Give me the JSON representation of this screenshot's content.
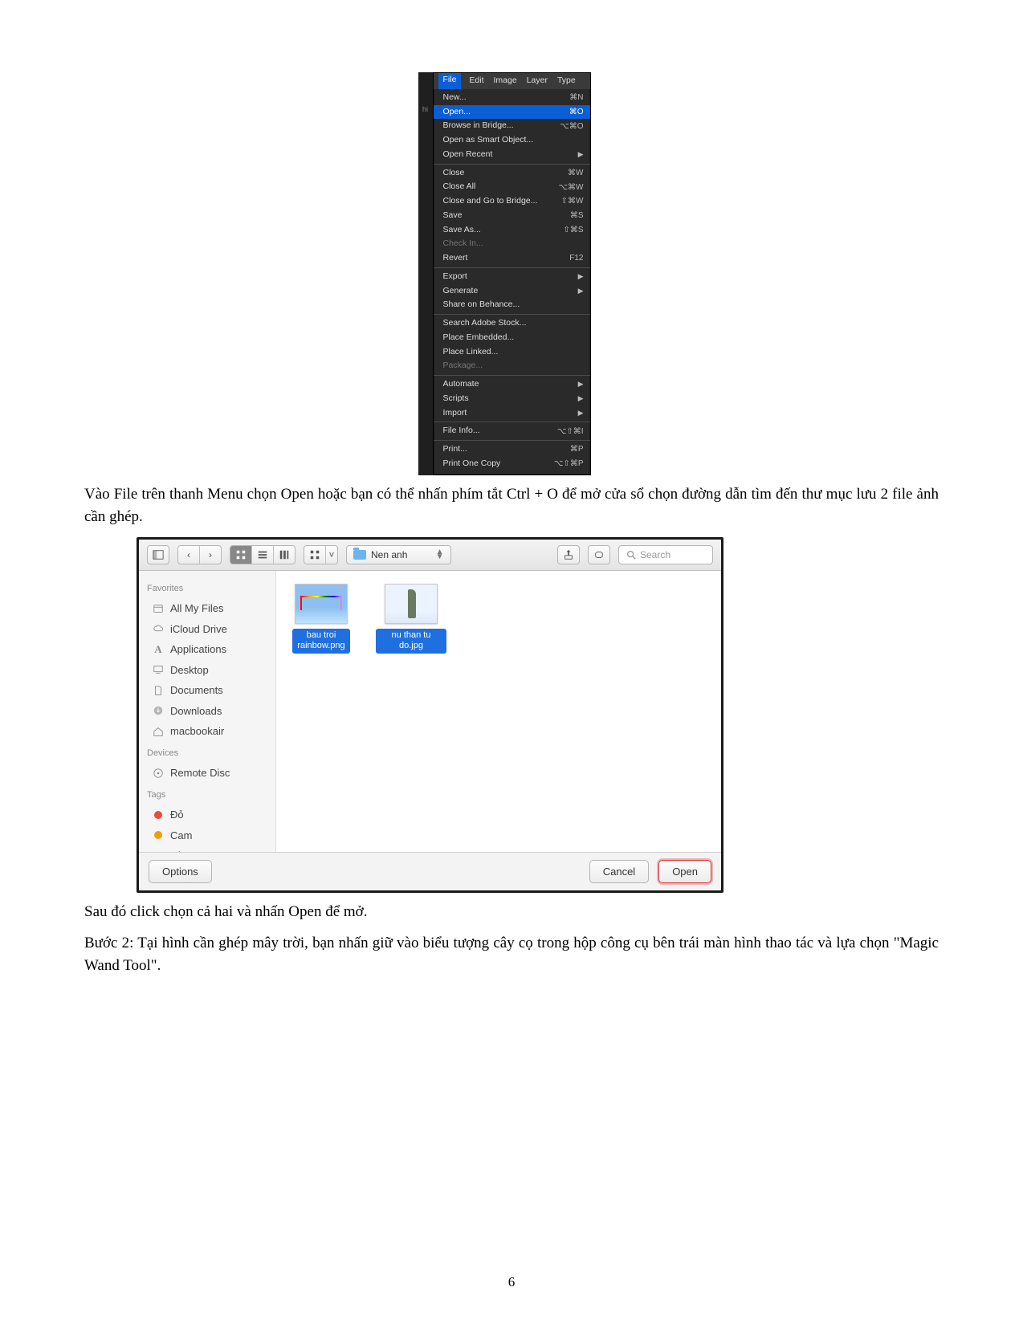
{
  "page_number": "6",
  "body_text": {
    "p1": "Vào File trên thanh Menu chọn Open hoặc bạn có thể nhấn phím tắt Ctrl + O để mở cửa sổ chọn đường dẫn tìm đến thư mục lưu 2 file ảnh cần ghép.",
    "p2": "Sau đó click chọn cả hai và nhấn Open để mở.",
    "p3": "Bước 2: Tại hình cần ghép mây trời, bạn nhấn giữ vào biểu tượng cây cọ trong hộp công cụ bên trái màn hình thao tác và lựa chọn \"Magic Wand Tool\"."
  },
  "ps_menu": {
    "menubar": [
      "File",
      "Edit",
      "Image",
      "Layer",
      "Type"
    ],
    "highlighted": "Open...",
    "groups": [
      [
        {
          "label": "New...",
          "sc": "⌘N"
        },
        {
          "label": "Open...",
          "sc": "⌘O",
          "selected": true
        },
        {
          "label": "Browse in Bridge...",
          "sc": "⌥⌘O"
        },
        {
          "label": "Open as Smart Object..."
        },
        {
          "label": "Open Recent",
          "arrow": true
        }
      ],
      [
        {
          "label": "Close",
          "sc": "⌘W"
        },
        {
          "label": "Close All",
          "sc": "⌥⌘W"
        },
        {
          "label": "Close and Go to Bridge...",
          "sc": "⇧⌘W"
        },
        {
          "label": "Save",
          "sc": "⌘S"
        },
        {
          "label": "Save As...",
          "sc": "⇧⌘S"
        },
        {
          "label": "Check In...",
          "disabled": true
        },
        {
          "label": "Revert",
          "sc": "F12"
        }
      ],
      [
        {
          "label": "Export",
          "arrow": true
        },
        {
          "label": "Generate",
          "arrow": true
        },
        {
          "label": "Share on Behance..."
        }
      ],
      [
        {
          "label": "Search Adobe Stock..."
        },
        {
          "label": "Place Embedded..."
        },
        {
          "label": "Place Linked..."
        },
        {
          "label": "Package...",
          "disabled": true
        }
      ],
      [
        {
          "label": "Automate",
          "arrow": true
        },
        {
          "label": "Scripts",
          "arrow": true
        },
        {
          "label": "Import",
          "arrow": true
        }
      ],
      [
        {
          "label": "File Info...",
          "sc": "⌥⇧⌘I"
        }
      ],
      [
        {
          "label": "Print...",
          "sc": "⌘P"
        },
        {
          "label": "Print One Copy",
          "sc": "⌥⇧⌘P"
        }
      ]
    ]
  },
  "finder": {
    "folder_name": "Nen anh",
    "search_placeholder": "Search",
    "sidebar": {
      "favorites_head": "Favorites",
      "favorites": [
        {
          "icon": "all",
          "label": "All My Files"
        },
        {
          "icon": "cloud",
          "label": "iCloud Drive"
        },
        {
          "icon": "apps",
          "label": "Applications"
        },
        {
          "icon": "desktop",
          "label": "Desktop"
        },
        {
          "icon": "docs",
          "label": "Documents"
        },
        {
          "icon": "down",
          "label": "Downloads"
        },
        {
          "icon": "home",
          "label": "macbookair"
        }
      ],
      "devices_head": "Devices",
      "devices": [
        {
          "icon": "disc",
          "label": "Remote Disc"
        }
      ],
      "tags_head": "Tags",
      "tags": [
        {
          "color": "#e74c3c",
          "label": "Đỏ"
        },
        {
          "color": "#f39c12",
          "label": "Cam"
        },
        {
          "color": "#f1c40f",
          "label": "Vàng"
        }
      ]
    },
    "files": [
      {
        "name": "bau troi\nrainbow.png",
        "kind": "sky"
      },
      {
        "name": "nu than tu do.jpg",
        "kind": "statue"
      }
    ],
    "footer": {
      "options": "Options",
      "cancel": "Cancel",
      "open": "Open"
    }
  }
}
